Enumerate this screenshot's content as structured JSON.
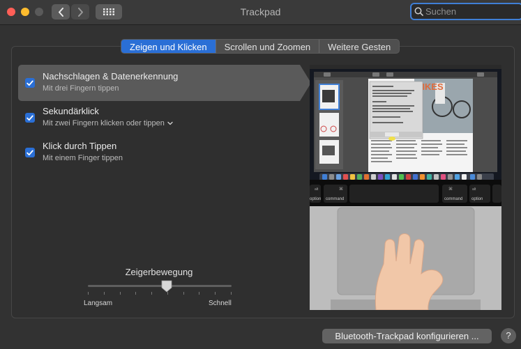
{
  "window": {
    "title": "Trackpad"
  },
  "search": {
    "placeholder": "Suchen"
  },
  "tabs": [
    {
      "label": "Zeigen und Klicken"
    },
    {
      "label": "Scrollen und Zoomen"
    },
    {
      "label": "Weitere Gesten"
    }
  ],
  "options": [
    {
      "title": "Nachschlagen & Datenerkennung",
      "subtitle": "Mit drei Fingern tippen",
      "checked": true
    },
    {
      "title": "Sekundärklick",
      "subtitle": "Mit zwei Fingern klicken oder tippen",
      "checked": true
    },
    {
      "title": "Klick durch Tippen",
      "subtitle": "Mit einem Finger tippen",
      "checked": true
    }
  ],
  "tracking": {
    "label": "Zeigerbewegung",
    "min_label": "Langsam",
    "max_label": "Schnell",
    "value": 0.55,
    "ticks": 10
  },
  "preview": {
    "doc_heading": "BIKES",
    "key_left_top": "alt",
    "key_left": "option",
    "key_cmd": "command",
    "key_right_cmd": "command",
    "key_right_top": "alt",
    "key_right": "option"
  },
  "footer": {
    "bluetooth_button": "Bluetooth-Trackpad konfigurieren ...",
    "help": "?"
  },
  "colors": {
    "accent": "#2a6fd6",
    "search_focus": "#3f7fd6"
  }
}
